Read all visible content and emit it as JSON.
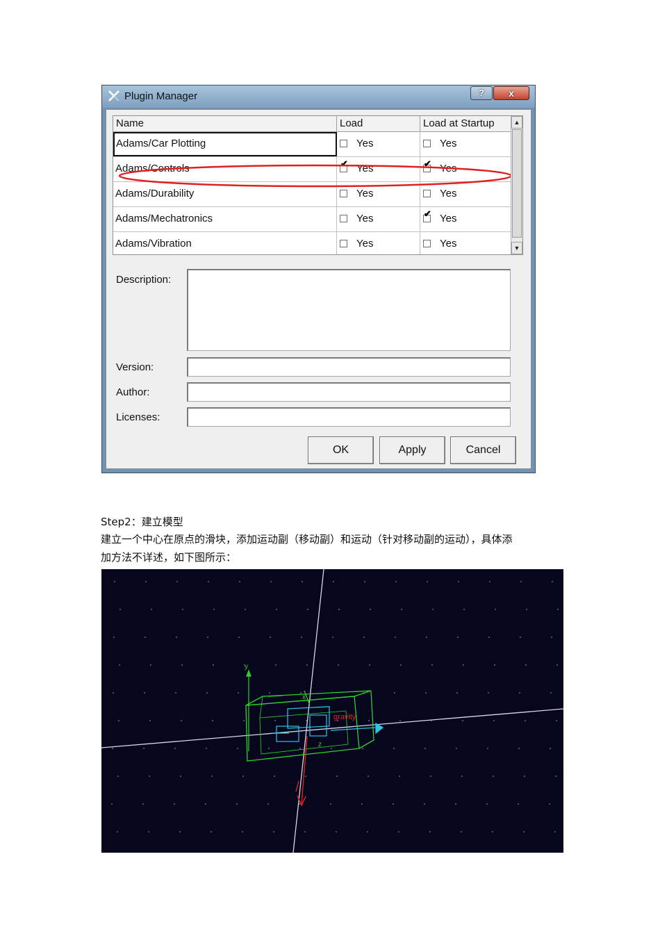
{
  "dialog": {
    "title": "Plugin Manager",
    "help_label": "?",
    "close_label": "x",
    "table": {
      "headers": {
        "name": "Name",
        "load": "Load",
        "startup": "Load at Startup"
      },
      "rows": [
        {
          "name": "Adams/Car Plotting",
          "load_label": "Yes",
          "load": false,
          "startup_label": "Yes",
          "startup": false
        },
        {
          "name": "Adams/Controls",
          "load_label": "Yes",
          "load": true,
          "startup_label": "Yes",
          "startup": true
        },
        {
          "name": "Adams/Durability",
          "load_label": "Yes",
          "load": false,
          "startup_label": "Yes",
          "startup": false
        },
        {
          "name": "Adams/Mechatronics",
          "load_label": "Yes",
          "load": false,
          "startup_label": "Yes",
          "startup": true
        },
        {
          "name": "Adams/Vibration",
          "load_label": "Yes",
          "load": false,
          "startup_label": "Yes",
          "startup": false
        }
      ]
    },
    "fields": {
      "description_label": "Description:",
      "version_label": "Version:",
      "author_label": "Author:",
      "licenses_label": "Licenses:",
      "description_value": "",
      "version_value": "",
      "author_value": "",
      "licenses_value": ""
    },
    "buttons": {
      "ok": "OK",
      "apply": "Apply",
      "cancel": "Cancel"
    },
    "highlight_color": "#e02020"
  },
  "doc": {
    "step": "Step2：建立模型",
    "para_line1": "建立一个中心在原点的滑块，添加运动副（移动副）和运动（针对移动副的运动），具体添",
    "para_line2": "加方法不详述，如下图所示："
  },
  "model_view": {
    "labels": {
      "gravity": "gravity",
      "y": "y",
      "x": "x",
      "z": "z"
    },
    "colors": {
      "background": "#06061c",
      "block": "#2fd12f",
      "joint": "#29c7e8",
      "gravity": "#e02424",
      "axis": "#d8d8e8"
    }
  }
}
